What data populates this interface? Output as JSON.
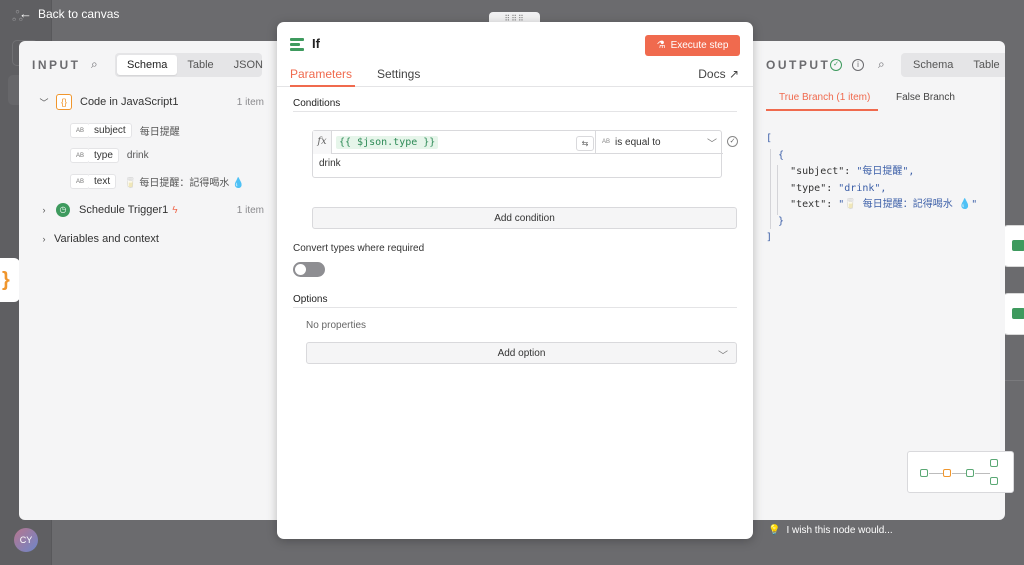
{
  "nav": {
    "back_label": "Back to canvas"
  },
  "input_panel": {
    "heading": "INPUT",
    "view_tabs": [
      "Schema",
      "Table",
      "JSON"
    ],
    "active_view": "Schema",
    "tree": {
      "code_node": {
        "name": "Code in JavaScript1",
        "count": "1 item"
      },
      "fields": [
        {
          "type_badge": "AB",
          "name": "subject",
          "value": "每日提醒"
        },
        {
          "type_badge": "AB",
          "name": "type",
          "value": "drink"
        },
        {
          "type_badge": "AB",
          "name": "text",
          "value": "🥛 每日提醒：記得喝水 💧"
        }
      ],
      "schedule_node": {
        "name": "Schedule Trigger1",
        "count": "1 item"
      },
      "variables_label": "Variables and context"
    }
  },
  "node_panel": {
    "title": "If",
    "execute_label": "Execute step",
    "tabs": [
      "Parameters",
      "Settings"
    ],
    "active_tab": "Parameters",
    "docs_label": "Docs",
    "conditions_title": "Conditions",
    "condition": {
      "fx_label": "fx",
      "left_expression": "{{ $json.type }}",
      "type_badge": "AB",
      "operator": "is equal to",
      "right_value": "drink"
    },
    "add_condition_label": "Add condition",
    "convert_types_label": "Convert types where required",
    "convert_types_enabled": false,
    "options_title": "Options",
    "no_properties_label": "No properties",
    "add_option_label": "Add option"
  },
  "output_panel": {
    "heading": "OUTPUT",
    "view_tabs": [
      "Schema",
      "Table"
    ],
    "branch_tabs": [
      "True Branch (1 item)",
      "False Branch"
    ],
    "active_branch": "True Branch (1 item)",
    "json_lines": {
      "open_array": "[",
      "open_obj": "{",
      "subject_key": "\"subject\"",
      "subject_val": "\"每日提醒\",",
      "type_key": "\"type\"",
      "type_val": "\"drink\",",
      "text_key": "\"text\"",
      "text_val": "\"🥛 每日提醒：記得喝水 💧\"",
      "close_obj": "}",
      "close_array": "]"
    }
  },
  "footer": {
    "wish_label": "I wish this node would..."
  },
  "colors": {
    "accent": "#f06a4e",
    "success": "#3e9a5e",
    "code_orange": "#f0962d",
    "json_string": "#3c5fa8"
  }
}
